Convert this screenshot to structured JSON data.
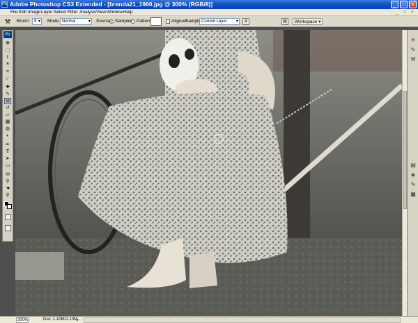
{
  "window": {
    "title": "Adobe Photoshop CS3 Extended - [brenda21_1960.jpg @ 300% (RGB/8)]",
    "badge": "Ps",
    "controls": [
      "_",
      "□",
      "×"
    ]
  },
  "menu": {
    "items": [
      "File",
      "Edit",
      "Image",
      "Layer",
      "Select",
      "Filter",
      "Analysis",
      "View",
      "Window",
      "Help"
    ],
    "doc_controls": [
      "_",
      "□",
      "×"
    ]
  },
  "options": {
    "brush_label": "Brush:",
    "brush_size": "9",
    "mode_label": "Mode:",
    "mode_value": "Normal",
    "source_label": "Source:",
    "sampled_label": "Sampled",
    "pattern_label": "Pattern:",
    "aligned_label": "Aligned",
    "sample_label": "Sample:",
    "sample_value": "Current Layer",
    "workspace_label": "Workspace ▾"
  },
  "toolbox": {
    "logo": "Ps",
    "tools": [
      "move-tool",
      "marquee-tool",
      "lasso-tool",
      "magic-wand-tool",
      "crop-tool",
      "slice-tool",
      "healing-brush-tool",
      "brush-tool",
      "clone-stamp-tool",
      "history-brush-tool",
      "eraser-tool",
      "gradient-tool",
      "blur-tool",
      "dodge-tool",
      "pen-tool",
      "type-tool",
      "path-selection-tool",
      "shape-tool",
      "notes-tool",
      "eyedropper-tool",
      "hand-tool",
      "zoom-tool"
    ]
  },
  "canvas": {
    "image_description_icon": "photo-image"
  },
  "dock": {
    "icons": [
      "star-icon",
      "brush-preset-icon",
      "clone-source-icon",
      "layers-icon",
      "channels-icon",
      "paths-icon",
      "history-icon"
    ]
  },
  "status": {
    "zoom": "300%",
    "doc": "Doc: 1.10M/1.10M",
    "arrow": "▸"
  },
  "colors": {
    "title_bar": "#0f4fc4",
    "chrome": "#ece9d8",
    "options_bar": "#dcd9cb"
  }
}
